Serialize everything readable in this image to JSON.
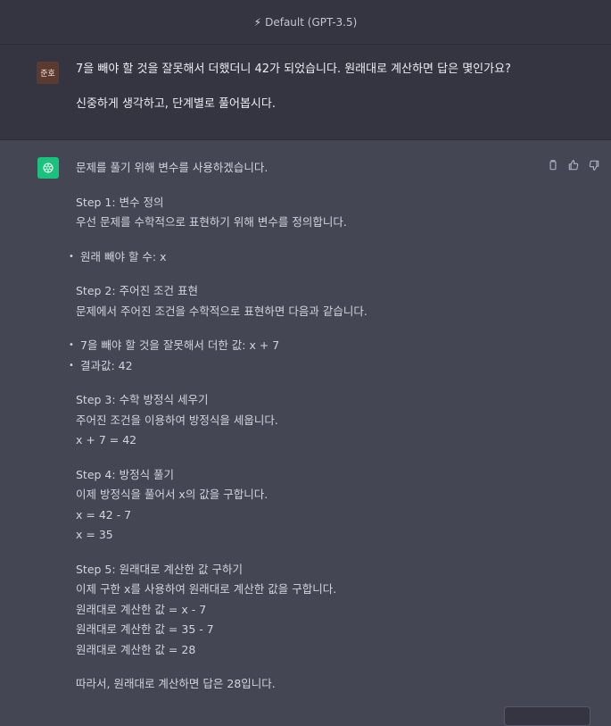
{
  "header": {
    "model_label": "Default (GPT-3.5)"
  },
  "user": {
    "avatar_text": "준호",
    "messages": [
      "7을 빼야 할 것을 잘못해서 더했더니 42가 되었습니다. 원래대로 계산하면 답은 몇인가요?",
      "신중하게 생각하고, 단계별로 풀어봅시다."
    ]
  },
  "assistant": {
    "lines": {
      "intro": "문제를 풀기 위해 변수를 사용하겠습니다.",
      "s1_title": "Step 1: 변수 정의",
      "s1_desc": "우선 문제를 수학적으로 표현하기 위해 변수를 정의합니다.",
      "s1_b1": "원래 빼야 할 수: x",
      "s2_title": "Step 2: 주어진 조건 표현",
      "s2_desc": "문제에서 주어진 조건을 수학적으로 표현하면 다음과 같습니다.",
      "s2_b1": "7을 빼야 할 것을 잘못해서 더한 값: x + 7",
      "s2_b2": "결과값: 42",
      "s3_title": "Step 3: 수학 방정식 세우기",
      "s3_desc": "주어진 조건을 이용하여 방정식을 세웁니다.",
      "s3_eq": "x + 7 = 42",
      "s4_title": "Step 4: 방정식 풀기",
      "s4_desc": "이제 방정식을 풀어서 x의 값을 구합니다.",
      "s4_eq1": "x = 42 - 7",
      "s4_eq2": "x = 35",
      "s5_title": "Step 5: 원래대로 계산한 값 구하기",
      "s5_desc": "이제 구한 x를 사용하여 원래대로 계산한 값을 구합니다.",
      "s5_eq1": "원래대로 계산한 값 = x - 7",
      "s5_eq2": "원래대로 계산한 값 = 35 - 7",
      "s5_eq3": "원래대로 계산한 값 = 28",
      "conclusion": "따라서, 원래대로 계산하면 답은 28입니다."
    },
    "action_icons": [
      "copy-icon",
      "thumbs-up-icon",
      "thumbs-down-icon"
    ]
  },
  "colors": {
    "bot_avatar": "#19c37d",
    "user_avatar": "#5b3a2f"
  }
}
